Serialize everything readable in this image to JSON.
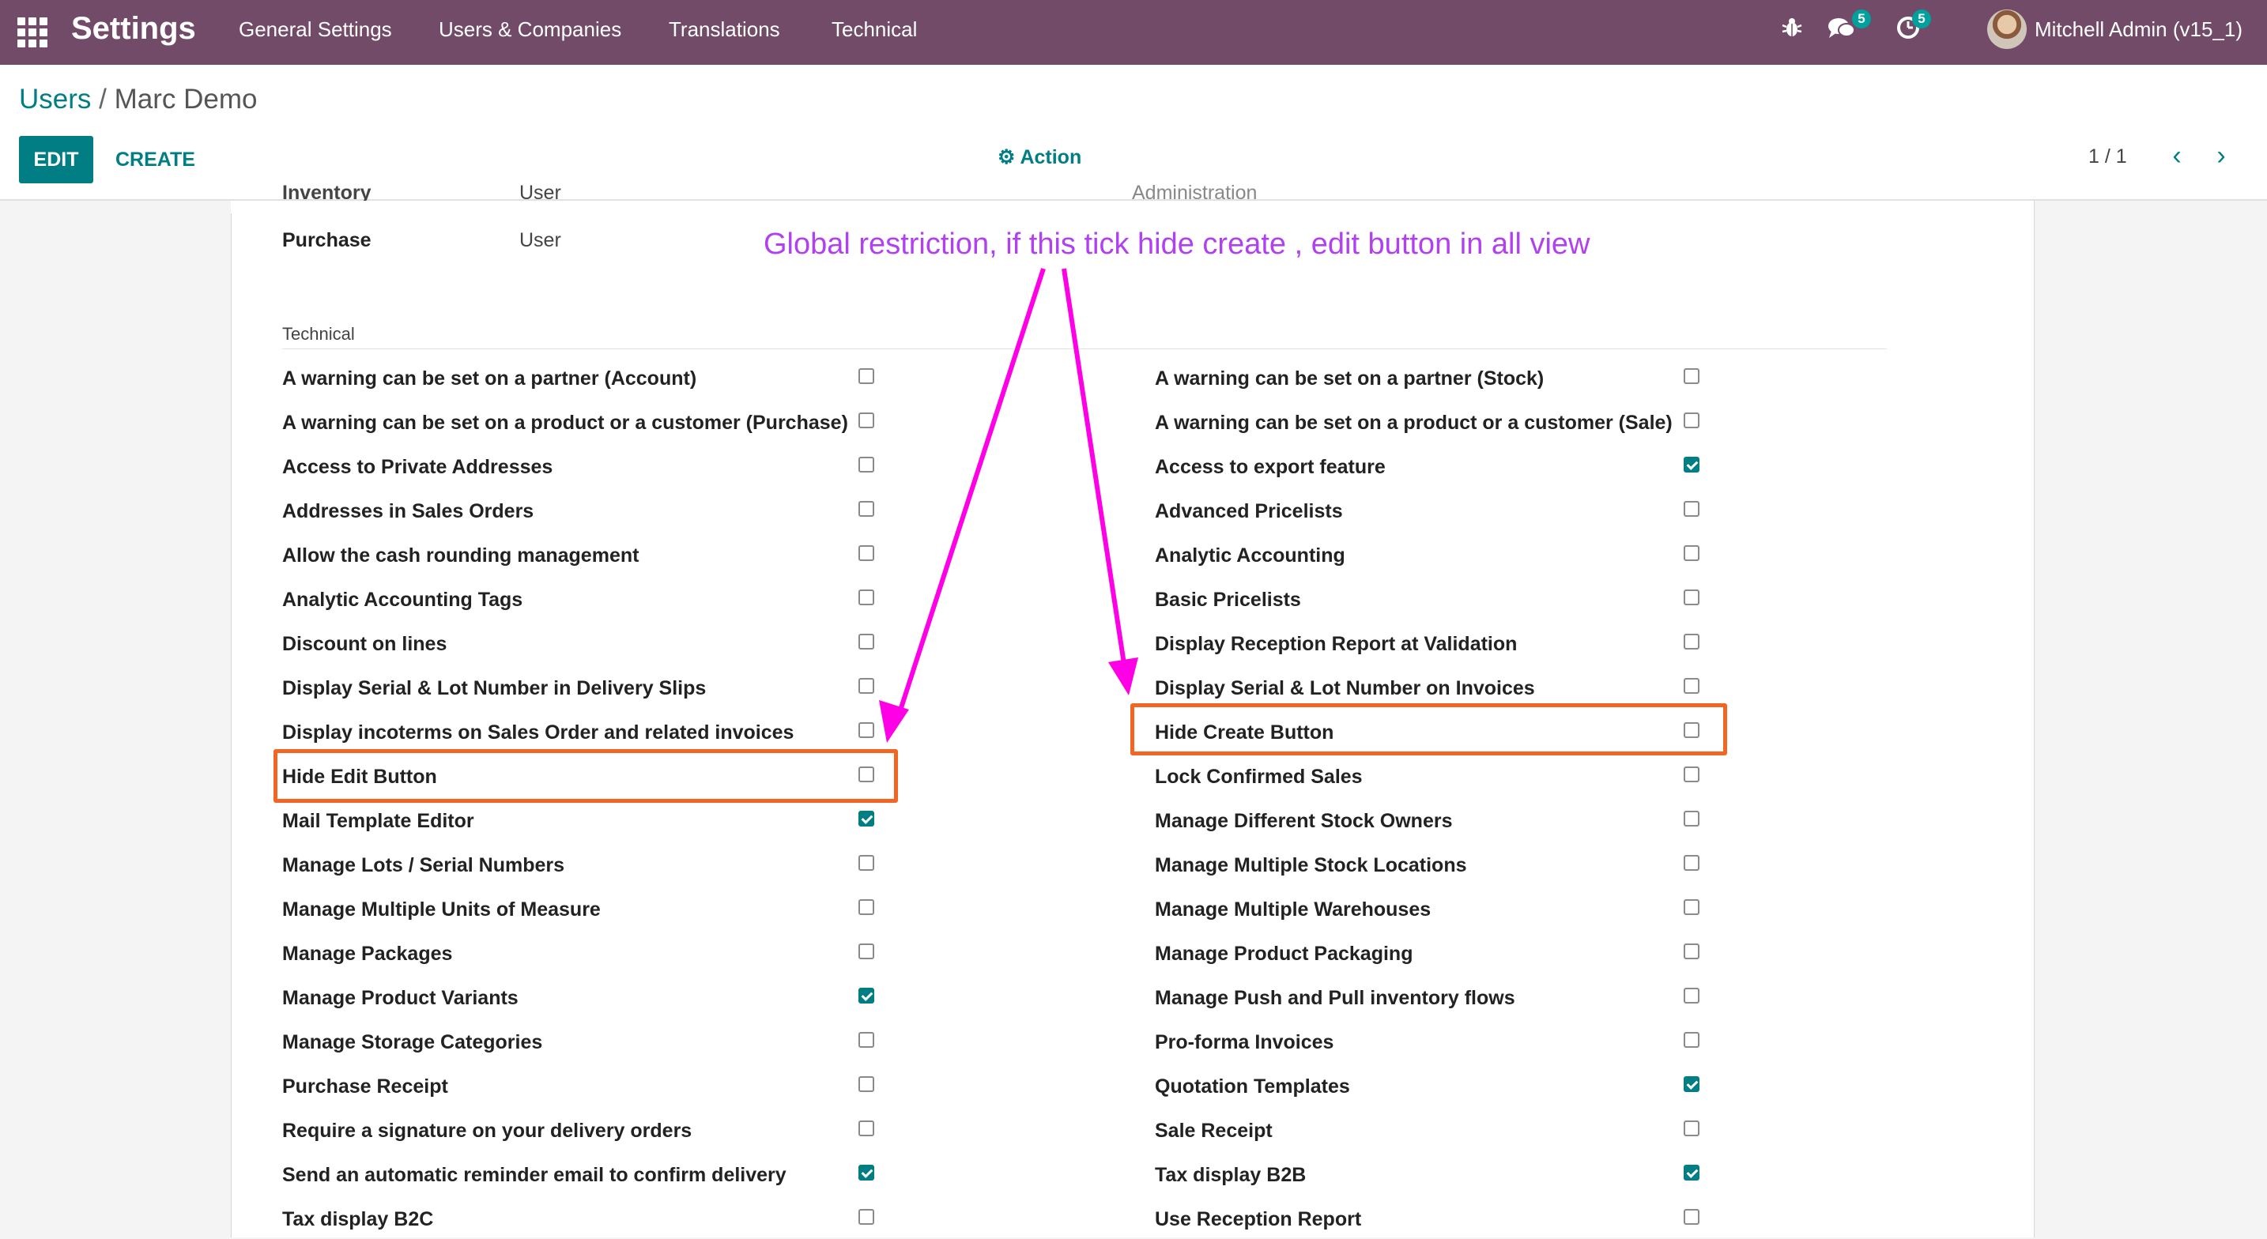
{
  "navbar": {
    "brand": "Settings",
    "menu": [
      "General Settings",
      "Users & Companies",
      "Translations",
      "Technical"
    ],
    "messages_count": "5",
    "activities_count": "5",
    "user": "Mitchell Admin (v15_1)"
  },
  "control_panel": {
    "breadcrumb_parent": "Users",
    "breadcrumb_sep": "/",
    "breadcrumb_current": "Marc Demo",
    "edit_label": "EDIT",
    "create_label": "CREATE",
    "action_label": "Action",
    "pager": "1 / 1"
  },
  "partial_top": {
    "left_label": "Inventory",
    "left_value": "User",
    "right_label": "Administration"
  },
  "purchase": {
    "label": "Purchase",
    "value": "User"
  },
  "section_title": "Technical",
  "annotation": "Global restriction, if this tick hide create , edit button in all view",
  "left_items": [
    {
      "label": "A warning can be set on a partner (Account)",
      "checked": false
    },
    {
      "label": "A warning can be set on a product or a customer (Purchase)",
      "checked": false
    },
    {
      "label": "Access to Private Addresses",
      "checked": false
    },
    {
      "label": "Addresses in Sales Orders",
      "checked": false
    },
    {
      "label": "Allow the cash rounding management",
      "checked": false
    },
    {
      "label": "Analytic Accounting Tags",
      "checked": false
    },
    {
      "label": "Discount on lines",
      "checked": false
    },
    {
      "label": "Display Serial & Lot Number in Delivery Slips",
      "checked": false
    },
    {
      "label": "Display incoterms on Sales Order and related invoices",
      "checked": false
    },
    {
      "label": "Hide Edit Button",
      "checked": false
    },
    {
      "label": "Mail Template Editor",
      "checked": true
    },
    {
      "label": "Manage Lots / Serial Numbers",
      "checked": false
    },
    {
      "label": "Manage Multiple Units of Measure",
      "checked": false
    },
    {
      "label": "Manage Packages",
      "checked": false
    },
    {
      "label": "Manage Product Variants",
      "checked": true
    },
    {
      "label": "Manage Storage Categories",
      "checked": false
    },
    {
      "label": "Purchase Receipt",
      "checked": false
    },
    {
      "label": "Require a signature on your delivery orders",
      "checked": false
    },
    {
      "label": "Send an automatic reminder email to confirm delivery",
      "checked": true
    },
    {
      "label": "Tax display B2C",
      "checked": false
    }
  ],
  "right_items": [
    {
      "label": "A warning can be set on a partner (Stock)",
      "checked": false
    },
    {
      "label": "A warning can be set on a product or a customer (Sale)",
      "checked": false
    },
    {
      "label": "Access to export feature",
      "checked": true
    },
    {
      "label": "Advanced Pricelists",
      "checked": false
    },
    {
      "label": "Analytic Accounting",
      "checked": false
    },
    {
      "label": "Basic Pricelists",
      "checked": false
    },
    {
      "label": "Display Reception Report at Validation",
      "checked": false
    },
    {
      "label": "Display Serial & Lot Number on Invoices",
      "checked": false
    },
    {
      "label": "Hide Create Button",
      "checked": false
    },
    {
      "label": "Lock Confirmed Sales",
      "checked": false
    },
    {
      "label": "Manage Different Stock Owners",
      "checked": false
    },
    {
      "label": "Manage Multiple Stock Locations",
      "checked": false
    },
    {
      "label": "Manage Multiple Warehouses",
      "checked": false
    },
    {
      "label": "Manage Product Packaging",
      "checked": false
    },
    {
      "label": "Manage Push and Pull inventory flows",
      "checked": false
    },
    {
      "label": "Pro-forma Invoices",
      "checked": false
    },
    {
      "label": "Quotation Templates",
      "checked": true
    },
    {
      "label": "Sale Receipt",
      "checked": false
    },
    {
      "label": "Tax display B2B",
      "checked": true
    },
    {
      "label": "Use Reception Report",
      "checked": false
    }
  ],
  "colors": {
    "navbar": "#714b67",
    "primary": "#017e84",
    "highlight_box": "#f26522",
    "annotation_text": "#b040f0",
    "arrow": "#ff00e6"
  },
  "icons": [
    "apps-grid-icon",
    "bug-icon",
    "chat-icon",
    "clock-icon",
    "gear-icon",
    "chevron-left-icon",
    "chevron-right-icon"
  ]
}
